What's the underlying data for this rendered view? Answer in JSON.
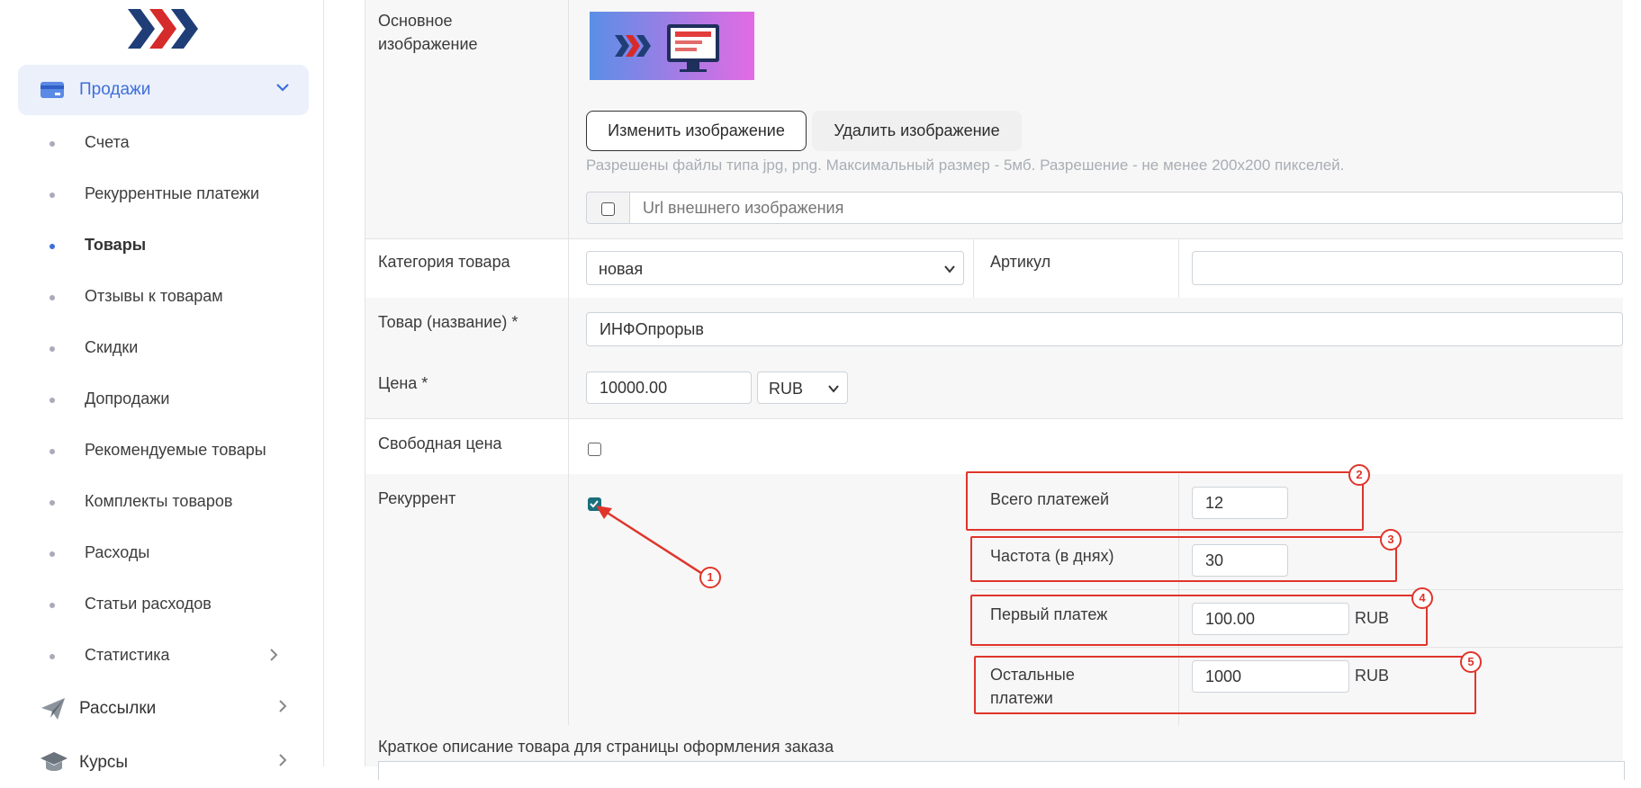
{
  "sidebar": {
    "logo": "brand-logo",
    "sales": {
      "label": "Продажи",
      "icon": "credit-card-icon"
    },
    "items": [
      {
        "label": "Счета"
      },
      {
        "label": "Рекуррентные платежи"
      },
      {
        "label": "Товары",
        "active": true
      },
      {
        "label": "Отзывы к товарам"
      },
      {
        "label": "Скидки"
      },
      {
        "label": "Допродажи"
      },
      {
        "label": "Рекомендуемые товары"
      },
      {
        "label": "Комплекты товаров"
      },
      {
        "label": "Расходы"
      },
      {
        "label": "Статьи расходов"
      },
      {
        "label": "Статистика"
      }
    ],
    "mailings": {
      "label": "Рассылки",
      "icon": "paper-plane-icon"
    },
    "courses": {
      "label": "Курсы",
      "icon": "graduation-cap-icon"
    }
  },
  "form": {
    "image": {
      "label": "Основное изображение",
      "change_button": "Изменить изображение",
      "delete_button": "Удалить изображение",
      "hint": "Разрешены файлы типа jpg, png. Максимальный размер - 5мб. Разрешение - не менее 200x200 пикселей.",
      "url_placeholder": "Url внешнего изображения"
    },
    "category": {
      "label": "Категория товара",
      "value": "новая"
    },
    "article": {
      "label": "Артикул",
      "value": ""
    },
    "name": {
      "label": "Товар (название) *",
      "value": "ИНФОпрорыв"
    },
    "price": {
      "label": "Цена *",
      "value": "10000.00",
      "currency": "RUB"
    },
    "free_price": {
      "label": "Свободная цена",
      "checked": false
    },
    "recurrent": {
      "label": "Рекуррент",
      "checked": true,
      "total_payments": {
        "label": "Всего платежей",
        "value": "12"
      },
      "frequency": {
        "label": "Частота (в днях)",
        "value": "30"
      },
      "first_payment": {
        "label": "Первый платеж",
        "value": "100.00",
        "currency": "RUB"
      },
      "other_payments": {
        "label": "Остальные платежи",
        "value": "1000",
        "currency": "RUB"
      }
    },
    "short_description": {
      "label": "Краткое описание товара для страницы оформления заказа"
    }
  },
  "annotations": {
    "markers": [
      "1",
      "2",
      "3",
      "4",
      "5"
    ],
    "color": "#e0352b"
  },
  "colors": {
    "accent": "#3f6fd8",
    "checkbox": "#1b6f7c"
  }
}
